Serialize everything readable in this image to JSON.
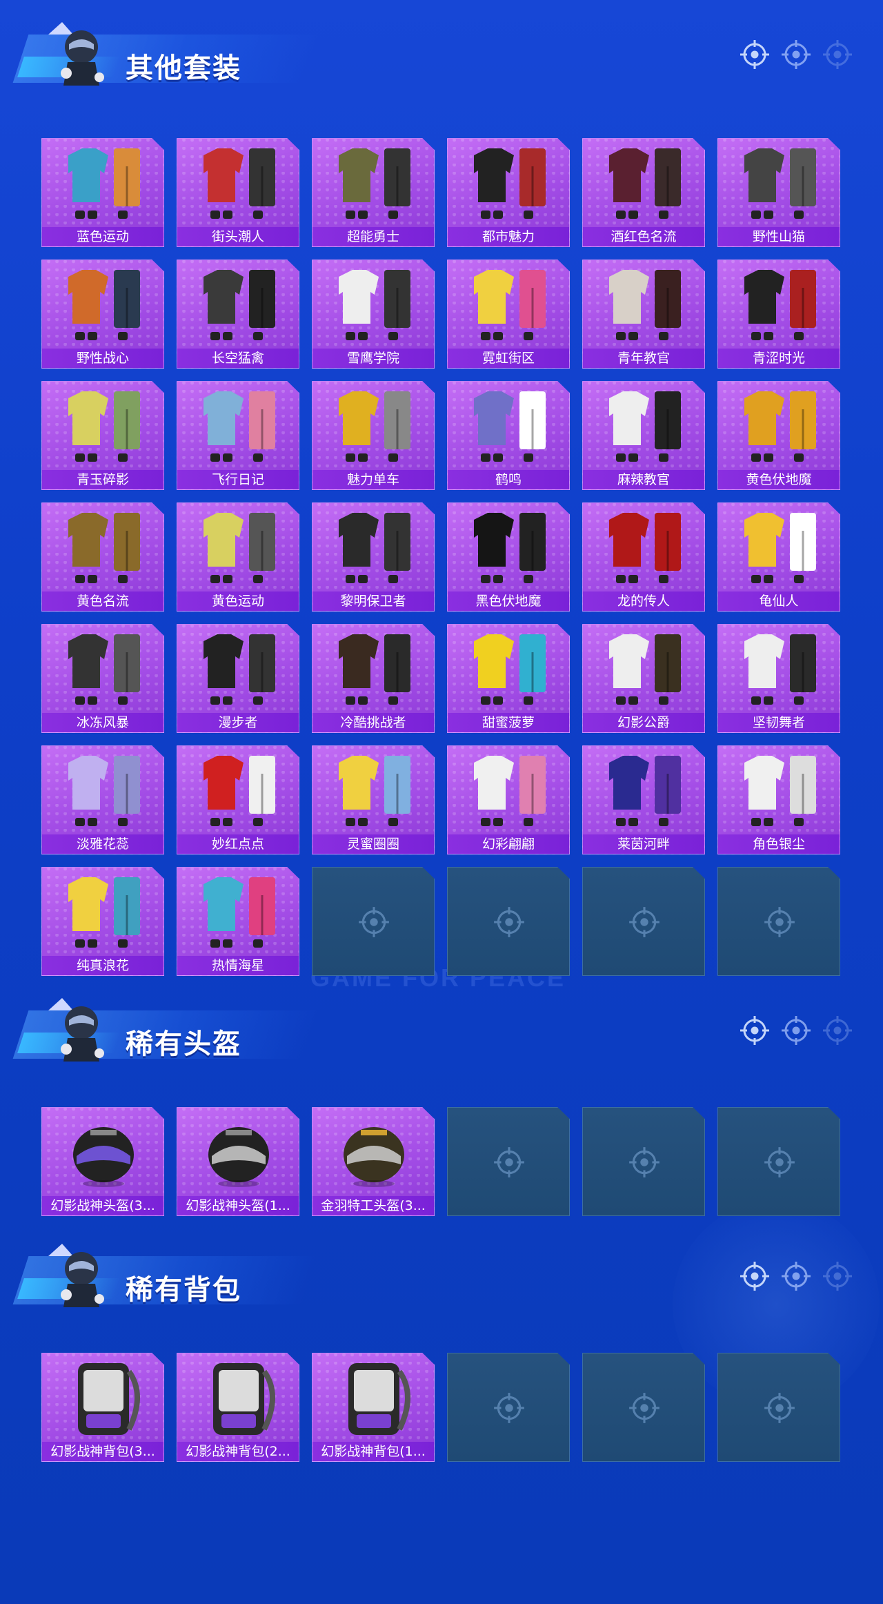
{
  "sections": [
    {
      "title": "其他套装",
      "items": [
        "蓝色运动",
        "街头潮人",
        "超能勇士",
        "都市魅力",
        "酒红色名流",
        "野性山猫",
        "野性战心",
        "长空猛禽",
        "雪鹰学院",
        "霓虹街区",
        "青年教官",
        "青涩时光",
        "青玉碎影",
        "飞行日记",
        "魅力单车",
        "鹤鸣",
        "麻辣教官",
        "黄色伏地魔",
        "黄色名流",
        "黄色运动",
        "黎明保卫者",
        "黑色伏地魔",
        "龙的传人",
        "龟仙人",
        "冰冻风暴",
        "漫步者",
        "冷酷挑战者",
        "甜蜜菠萝",
        "幻影公爵",
        "坚韧舞者",
        "淡雅花蕊",
        "妙红点点",
        "灵蜜圈圈",
        "幻彩翩翩",
        "莱茵河畔",
        "角色银尘",
        "纯真浪花",
        "热情海星"
      ],
      "empty_slots": 4
    },
    {
      "title": "稀有头盔",
      "items": [
        "幻影战神头盔(3...",
        "幻影战神头盔(1...",
        "金羽特工头盔(3..."
      ],
      "empty_slots": 3
    },
    {
      "title": "稀有背包",
      "items": [
        "幻影战神背包(3...",
        "幻影战神背包(2...",
        "幻影战神背包(1..."
      ],
      "empty_slots": 3
    }
  ],
  "watermark": "GAME FOR PEACE",
  "icons": {
    "header_marker": "crosshair-icon",
    "empty_slot": "crosshair-icon",
    "mascot": "soldier-avatar-icon"
  },
  "colors": {
    "tile": "#a34de6",
    "label": "#8a2fe0",
    "empty": "#23507c",
    "bg": "#1747d6"
  }
}
